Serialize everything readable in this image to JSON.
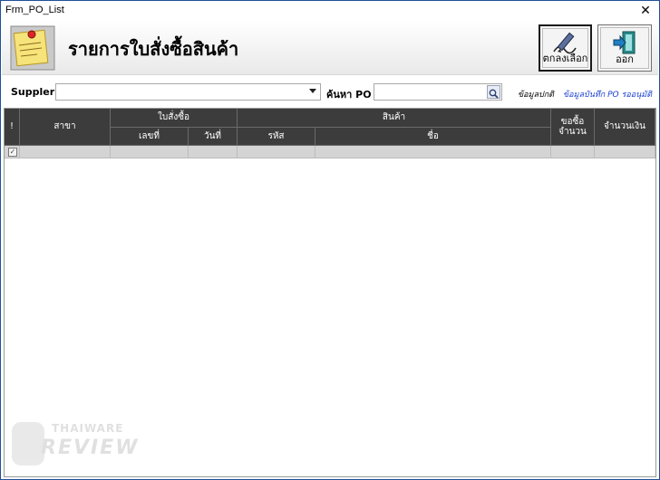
{
  "window": {
    "title": "Frm_PO_List",
    "close_glyph": "✕"
  },
  "header": {
    "title": "รายการใบสั่งซื้อสินค้า",
    "icon": "sticky-note-icon",
    "confirm_label": "ตกลงเลือก",
    "exit_label": "ออก"
  },
  "filters": {
    "supplier_label": "Suppler",
    "supplier_value": "",
    "po_search_label": "ค้นหา PO",
    "po_search_value": "",
    "link_basic": "ข้อมูลปกติ",
    "link_pending": "ข้อมูลบันทึก PO รออนุมัติ"
  },
  "grid": {
    "headers": {
      "mark": "!",
      "branch": "สาขา",
      "po_group": "ใบสั่งซื้อ",
      "po_number": "เลขที่",
      "po_date": "วันที่",
      "product_group": "สินค้า",
      "product_code": "รหัส",
      "product_name": "ชื่อ",
      "order_qty": "ขอซื้อ\nจำนวน",
      "amount": "จำนวนเงิน"
    },
    "rows": [
      {
        "checked": true
      }
    ]
  },
  "watermark": {
    "brand": "THAIWARE",
    "word": "REVIEW"
  },
  "colors": {
    "header_bg": "#3c3c3c",
    "row_bg": "#d4d4d4",
    "link_blue": "#1a3fd0"
  }
}
